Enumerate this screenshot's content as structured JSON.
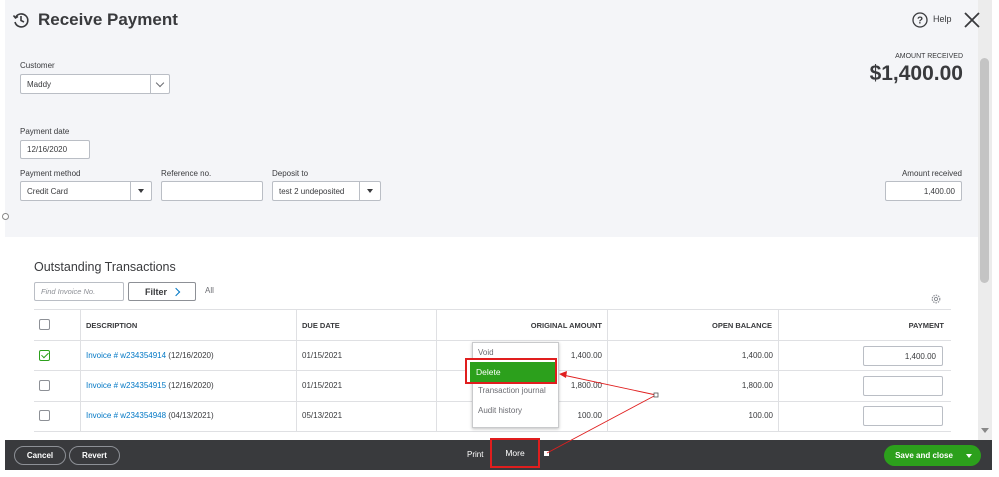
{
  "header": {
    "title": "Receive Payment",
    "help_label": "Help"
  },
  "customer": {
    "label": "Customer",
    "value": "Maddy"
  },
  "amount_summary": {
    "label": "AMOUNT RECEIVED",
    "value": "$1,400.00"
  },
  "payment_date": {
    "label": "Payment date",
    "value": "12/16/2020"
  },
  "payment_method": {
    "label": "Payment method",
    "value": "Credit Card"
  },
  "reference": {
    "label": "Reference no.",
    "value": ""
  },
  "deposit_to": {
    "label": "Deposit to",
    "value": "test 2 undeposited"
  },
  "amount_received": {
    "label": "Amount received",
    "value": "1,400.00"
  },
  "outstanding": {
    "title": "Outstanding Transactions",
    "search_placeholder": "Find Invoice No.",
    "filter_label": "Filter",
    "all_label": "All",
    "columns": {
      "description": "DESCRIPTION",
      "due_date": "DUE DATE",
      "original_amount": "ORIGINAL AMOUNT",
      "open_balance": "OPEN BALANCE",
      "payment": "PAYMENT"
    },
    "rows": [
      {
        "checked": true,
        "invoice": "Invoice # w234354914",
        "date": "(12/16/2020)",
        "due": "01/15/2021",
        "original": "1,400.00",
        "balance": "1,400.00",
        "payment": "1,400.00"
      },
      {
        "checked": false,
        "invoice": "Invoice # w234354915",
        "date": "(12/16/2020)",
        "due": "01/15/2021",
        "original": "1,800.00",
        "balance": "1,800.00",
        "payment": ""
      },
      {
        "checked": false,
        "invoice": "Invoice # w234354948",
        "date": "(04/13/2021)",
        "due": "05/13/2021",
        "original": "100.00",
        "balance": "100.00",
        "payment": ""
      }
    ]
  },
  "more_menu": {
    "items": [
      "Void",
      "Delete",
      "Transaction journal",
      "Audit history"
    ]
  },
  "footer": {
    "cancel": "Cancel",
    "revert": "Revert",
    "print": "Print",
    "more": "More",
    "save": "Save and close"
  },
  "colors": {
    "accent_green": "#2ca01c",
    "highlight_red": "#e01e1e",
    "link_blue": "#0077c5",
    "footer_bg": "#393a3d"
  }
}
